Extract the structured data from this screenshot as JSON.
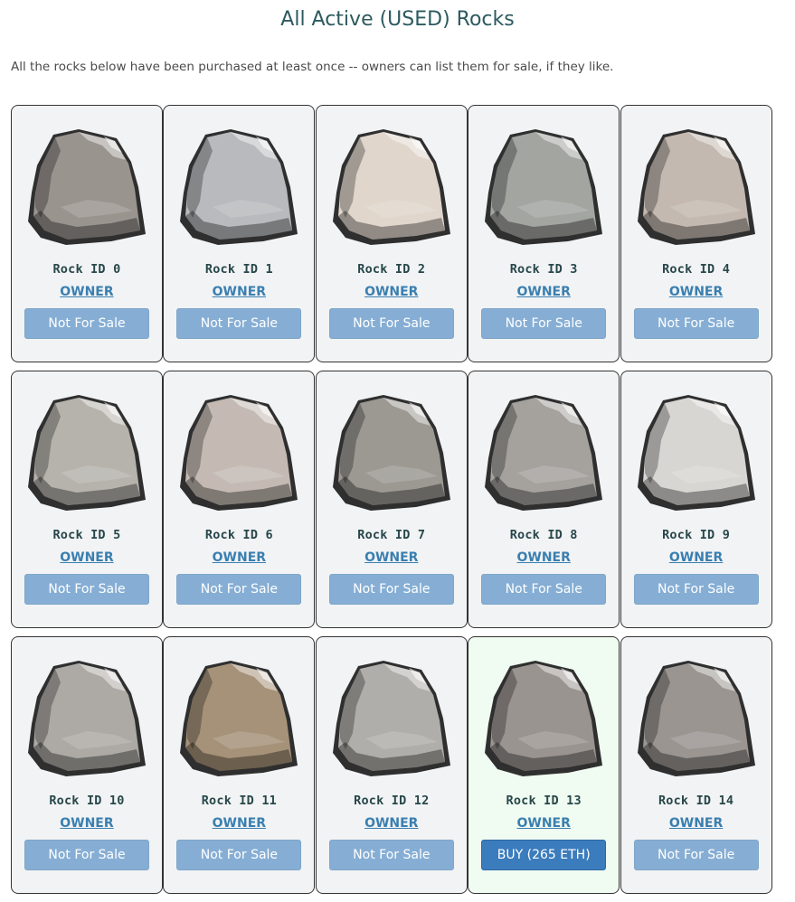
{
  "page": {
    "title": "All Active (USED) Rocks",
    "intro": "All the rocks below have been purchased at least once -- owners can list them for sale, if they like."
  },
  "colors": {
    "card_bg": "#f2f3f5",
    "card_bg_for_sale": "#f0fbf1",
    "button_disabled": "#86aed4",
    "button_buy": "#3b7cbd",
    "link": "#3a7fb0"
  },
  "rocks": [
    {
      "label": "Rock ID 0",
      "owner": "OWNER",
      "button": "Not For Sale",
      "for_sale": false,
      "tone": "#9a948f"
    },
    {
      "label": "Rock ID 1",
      "owner": "OWNER",
      "button": "Not For Sale",
      "for_sale": false,
      "tone": "#b8babd"
    },
    {
      "label": "Rock ID 2",
      "owner": "OWNER",
      "button": "Not For Sale",
      "for_sale": false,
      "tone": "#e0d6cc"
    },
    {
      "label": "Rock ID 3",
      "owner": "OWNER",
      "button": "Not For Sale",
      "for_sale": false,
      "tone": "#a3a5a1"
    },
    {
      "label": "Rock ID 4",
      "owner": "OWNER",
      "button": "Not For Sale",
      "for_sale": false,
      "tone": "#c4b9b0"
    },
    {
      "label": "Rock ID 5",
      "owner": "OWNER",
      "button": "Not For Sale",
      "for_sale": false,
      "tone": "#b6b3ac"
    },
    {
      "label": "Rock ID 6",
      "owner": "OWNER",
      "button": "Not For Sale",
      "for_sale": false,
      "tone": "#c4bab3"
    },
    {
      "label": "Rock ID 7",
      "owner": "OWNER",
      "button": "Not For Sale",
      "for_sale": false,
      "tone": "#9c9993"
    },
    {
      "label": "Rock ID 8",
      "owner": "OWNER",
      "button": "Not For Sale",
      "for_sale": false,
      "tone": "#a5a29e"
    },
    {
      "label": "Rock ID 9",
      "owner": "OWNER",
      "button": "Not For Sale",
      "for_sale": false,
      "tone": "#d7d6d3"
    },
    {
      "label": "Rock ID 10",
      "owner": "OWNER",
      "button": "Not For Sale",
      "for_sale": false,
      "tone": "#adaaa5"
    },
    {
      "label": "Rock ID 11",
      "owner": "OWNER",
      "button": "Not For Sale",
      "for_sale": false,
      "tone": "#a69279"
    },
    {
      "label": "Rock ID 12",
      "owner": "OWNER",
      "button": "Not For Sale",
      "for_sale": false,
      "tone": "#b0aeaa"
    },
    {
      "label": "Rock ID 13",
      "owner": "OWNER",
      "button": "BUY (265 ETH)",
      "for_sale": true,
      "tone": "#9a9490"
    },
    {
      "label": "Rock ID 14",
      "owner": "OWNER",
      "button": "Not For Sale",
      "for_sale": false,
      "tone": "#9a9591"
    }
  ]
}
